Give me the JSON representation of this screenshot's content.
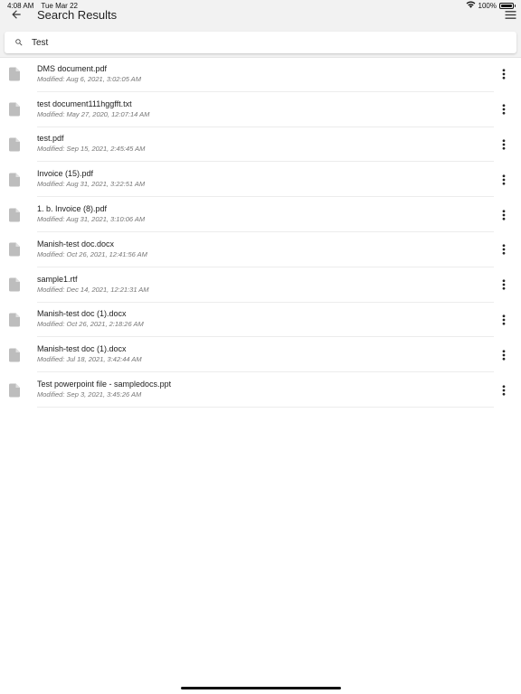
{
  "status_bar": {
    "time": "4:08 AM",
    "date": "Tue Mar 22",
    "battery": "100%"
  },
  "header": {
    "title": "Search Results"
  },
  "search": {
    "value": "Test",
    "placeholder": ""
  },
  "files": [
    {
      "name": "DMS document.pdf",
      "modified": "Modified: Aug 6, 2021, 3:02:05 AM"
    },
    {
      "name": "test document111hggfft.txt",
      "modified": "Modified: May 27, 2020, 12:07:14 AM"
    },
    {
      "name": "test.pdf",
      "modified": "Modified: Sep 15, 2021, 2:45:45 AM"
    },
    {
      "name": "Invoice (15).pdf",
      "modified": "Modified: Aug 31, 2021, 3:22:51 AM"
    },
    {
      "name": "1. b. Invoice (8).pdf",
      "modified": "Modified: Aug 31, 2021, 3:10:06 AM"
    },
    {
      "name": "Manish-test doc.docx",
      "modified": "Modified: Oct 26, 2021, 12:41:56 AM"
    },
    {
      "name": "sample1.rtf",
      "modified": "Modified: Dec 14, 2021, 12:21:31 AM"
    },
    {
      "name": "Manish-test doc (1).docx",
      "modified": "Modified: Oct 26, 2021, 2:18:26 AM"
    },
    {
      "name": "Manish-test doc (1).docx",
      "modified": "Modified: Jul 18, 2021, 3:42:44 AM"
    },
    {
      "name": "Test powerpoint file - sampledocs.ppt",
      "modified": "Modified: Sep 3, 2021, 3:45:26 AM"
    }
  ],
  "icons": {
    "back": "arrow-back-icon",
    "menu": "hamburger-menu-icon",
    "search": "search-icon",
    "file": "document-icon",
    "more": "more-vertical-icon",
    "wifi": "wifi-icon",
    "battery": "battery-icon"
  },
  "colors": {
    "header_bg": "#f2f2f2",
    "icon_gray": "#bdbdbd",
    "secondary_text": "#757575"
  }
}
